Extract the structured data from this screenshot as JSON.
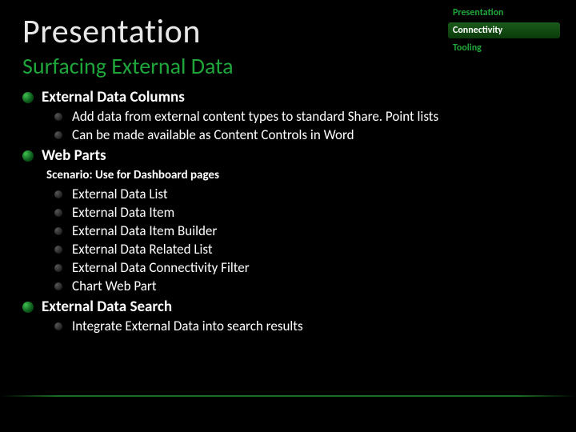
{
  "nav": {
    "items": [
      "Presentation",
      "Connectivity",
      "Tooling"
    ],
    "active_index": 1
  },
  "title": "Presentation",
  "subtitle": "Surfacing External Data",
  "sections": [
    {
      "heading": "External Data Columns",
      "items": [
        "Add data from external content types to standard Share. Point lists",
        "Can be made available as Content Controls in Word"
      ]
    },
    {
      "heading": "Web Parts",
      "scenario": "Scenario: Use for Dashboard pages",
      "items": [
        "External Data List",
        "External Data Item",
        "External Data Item Builder",
        "External Data Related List",
        "External Data Connectivity Filter",
        "Chart Web Part"
      ]
    },
    {
      "heading": "External Data Search",
      "items": [
        "Integrate External Data into search results"
      ]
    }
  ]
}
